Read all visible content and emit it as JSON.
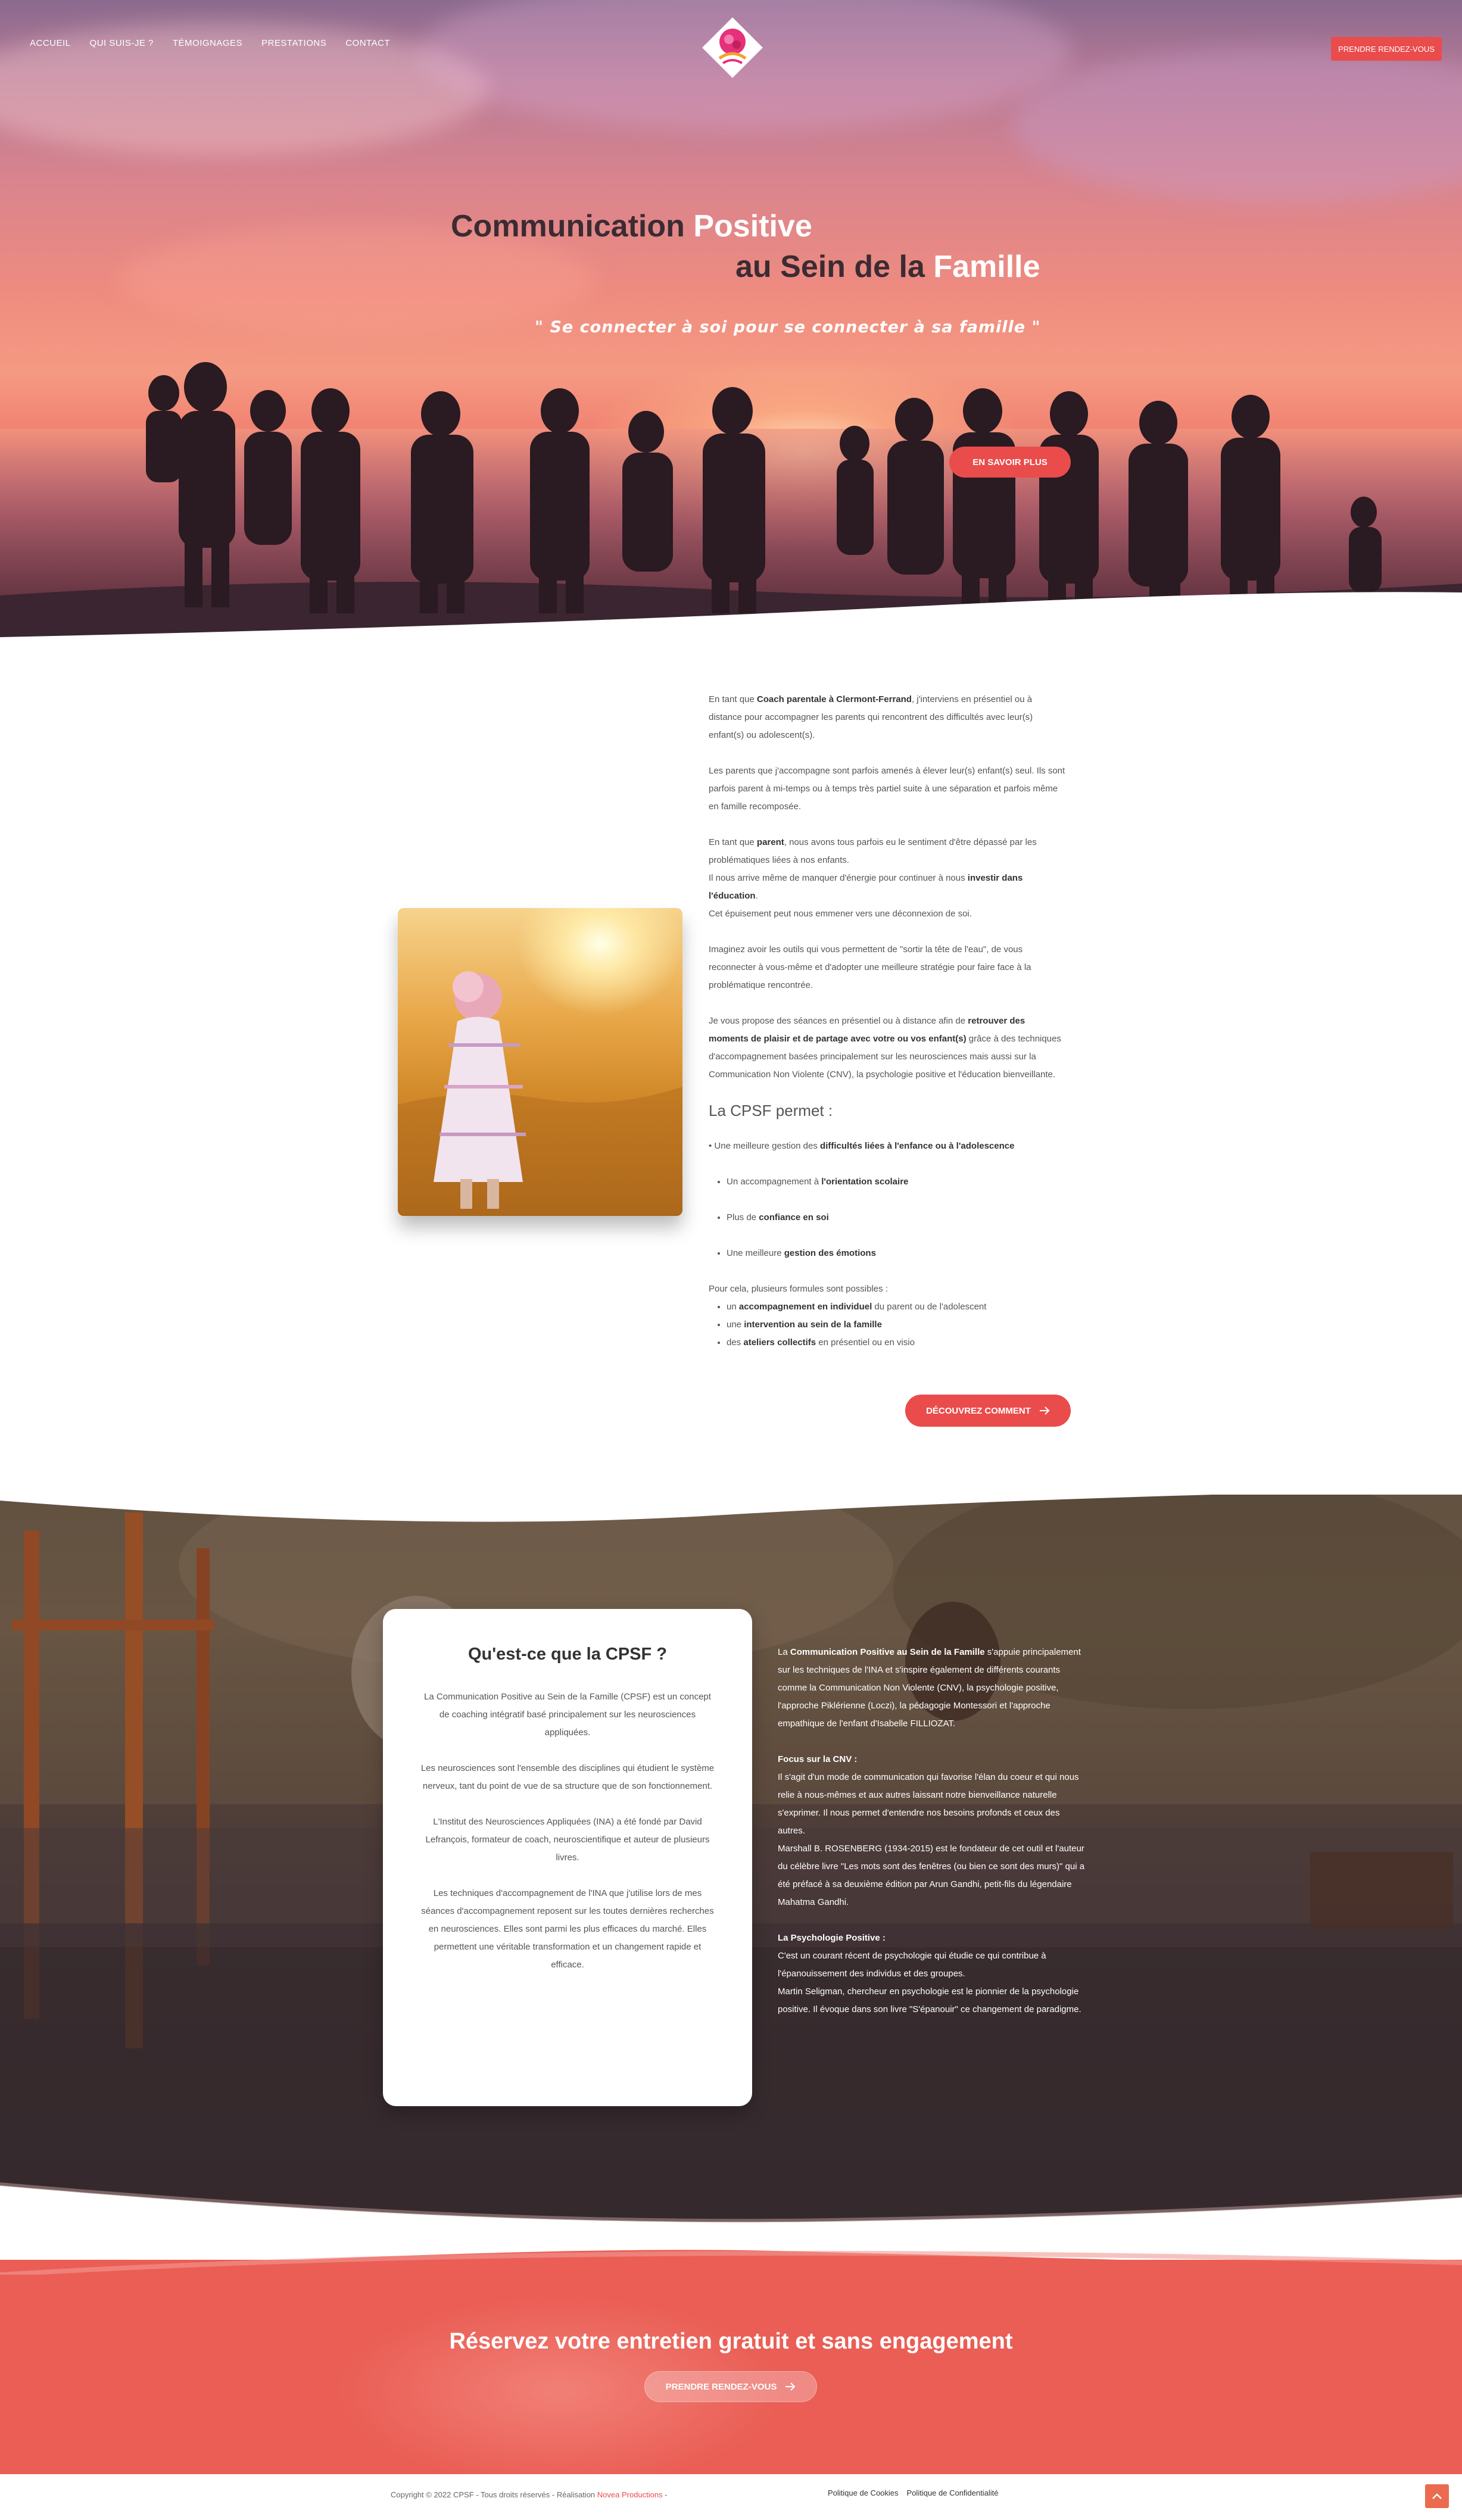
{
  "nav": {
    "items": [
      "ACCUEIL",
      "QUI SUIS-JE ?",
      "TÉMOIGNAGES",
      "PRESTATIONS",
      "CONTACT"
    ],
    "cta": "PRENDRE RENDEZ-VOUS"
  },
  "hero": {
    "title_line1_a": "Communication ",
    "title_line1_b": "Positive",
    "title_line2_a": "au Sein de la ",
    "title_line2_b": "Famille",
    "quote": "\" Se connecter à soi pour se connecter à sa famille \"",
    "button": "EN SAVOIR PLUS"
  },
  "intro": {
    "p1_a": "En tant que ",
    "p1_b": "Coach parentale à Clermont-Ferrand",
    "p1_c": ", j'interviens en présentiel ou à distance pour accompagner les parents qui rencontrent des difficultés avec leur(s) enfant(s) ou adolescent(s).",
    "p2": "Les parents que j'accompagne sont parfois amenés à élever leur(s) enfant(s) seul. Ils sont parfois parent à mi-temps ou à temps très partiel suite à une séparation et parfois même en famille recomposée.",
    "p3_a": "En tant que ",
    "p3_b": "parent",
    "p3_c": ", nous avons tous parfois eu le sentiment d'être dépassé par les problématiques liées à nos enfants.",
    "p3_d": "Il nous arrive même de manquer d'énergie pour continuer à nous ",
    "p3_e": "investir dans l'éducation",
    "p3_f": ".",
    "p3_g": "Cet épuisement peut nous emmener vers une déconnexion de soi.",
    "p4": "Imaginez avoir les outils qui vous permettent de \"sortir la tête de l'eau\", de vous reconnecter à vous-même et d'adopter une meilleure stratégie pour faire face à la problématique rencontrée.",
    "p5_a": "Je vous propose des séances en présentiel ou à distance afin de ",
    "p5_b": "retrouver des moments de plaisir et de partage avec votre ou vos enfant(s)",
    "p5_c": " grâce à des techniques d'accompagnement basées principalement sur les neurosciences mais aussi sur la Communication Non Violente (CNV), la psychologie positive et l'éducation bienveillante.",
    "cpsf_title": "La CPSF permet :",
    "b1_a": "• Une meilleure gestion des ",
    "b1_b": "difficultés liées à l'enfance ou à l'adolescence",
    "b2_a": "Un accompagnement à ",
    "b2_b": "l'orientation scolaire",
    "b3_a": "Plus de ",
    "b3_b": "confiance en soi",
    "b4_a": "Une meilleure ",
    "b4_b": "gestion des émotions",
    "formules": "Pour cela, plusieurs formules sont possibles :",
    "f1_a": "un ",
    "f1_b": "accompagnement en individuel",
    "f1_c": " du parent ou de l'adolescent",
    "f2_a": "une ",
    "f2_b": "intervention au sein de la famille",
    "f3_a": "des ",
    "f3_b": "ateliers collectifs",
    "f3_c": " en présentiel ou en visio",
    "button": "DÉCOUVREZ COMMENT"
  },
  "cpsf": {
    "title": "Qu'est-ce que la CPSF ?",
    "c1": "La Communication Positive au Sein de la Famille (CPSF) est un concept de coaching intégratif basé principalement sur les neurosciences appliquées.",
    "c2": "Les neurosciences sont l'ensemble des disciplines qui étudient le système nerveux, tant du point de vue de sa structure que de son fonctionnement.",
    "c3": "L'Institut des Neurosciences Appliquées (INA) a été fondé par David Lefrançois, formateur de coach, neuroscientifique et auteur de plusieurs livres.",
    "c4": "Les techniques d'accompagnement de l'INA que j'utilise lors de mes séances d'accompagnement reposent sur les toutes dernières recherches en neurosciences. Elles sont parmi les plus efficaces du marché. Elles permettent une véritable transformation et un changement rapide et efficace.",
    "r1_a": "La ",
    "r1_b": "Communication Positive au Sein de la Famille",
    "r1_c": " s'appuie principalement sur les techniques de l'INA et s'inspire également de différents courants comme la Communication Non Violente (CNV), la psychologie positive, l'approche Piklérienne (Loczi), la pédagogie Montessori et l'approche empathique de l'enfant d'Isabelle FILLIOZAT.",
    "r2_title": "Focus sur la CNV :",
    "r2_a": "Il s'agit d'un mode de communication qui favorise l'élan du coeur et qui nous relie à nous-mêmes et aux autres laissant notre bienveillance naturelle s'exprimer. Il nous permet d'entendre nos besoins profonds et ceux des autres.",
    "r2_b": "Marshall B. ROSENBERG (1934-2015) est le fondateur de cet outil et l'auteur du célèbre livre \"Les mots sont des fenêtres (ou bien ce sont des murs)\" qui a été préfacé à sa deuxième édition par Arun Gandhi, petit-fils du légendaire Mahatma Gandhi.",
    "r3_title": "La Psychologie Positive :",
    "r3_a": "C'est un courant récent de psychologie qui étudie ce qui contribue à l'épanouissement des individus et des groupes.",
    "r3_b": "Martin Seligman, chercheur en psychologie est le pionnier de la psychologie positive. Il évoque dans son livre \"S'épanouir\" ce changement de paradigme."
  },
  "rdv": {
    "title": "Réservez votre entretien gratuit et sans engagement",
    "button": "PRENDRE RENDEZ-VOUS"
  },
  "footer": {
    "copyright": "Copyright © 2022 CPSF - Tous droits réservés - Réalisation ",
    "agency": "Novea Productions",
    "agency_suffix": " -",
    "link_cookies": "Politique de Cookies",
    "link_privacy": "Politique de Confidentialité"
  },
  "colors": {
    "accent": "#ea4c4c",
    "rdv_bg": "#ea5e55",
    "dark_text": "#333333"
  },
  "icons": [
    "logo",
    "arrow-right-icon",
    "chevron-up-icon"
  ]
}
